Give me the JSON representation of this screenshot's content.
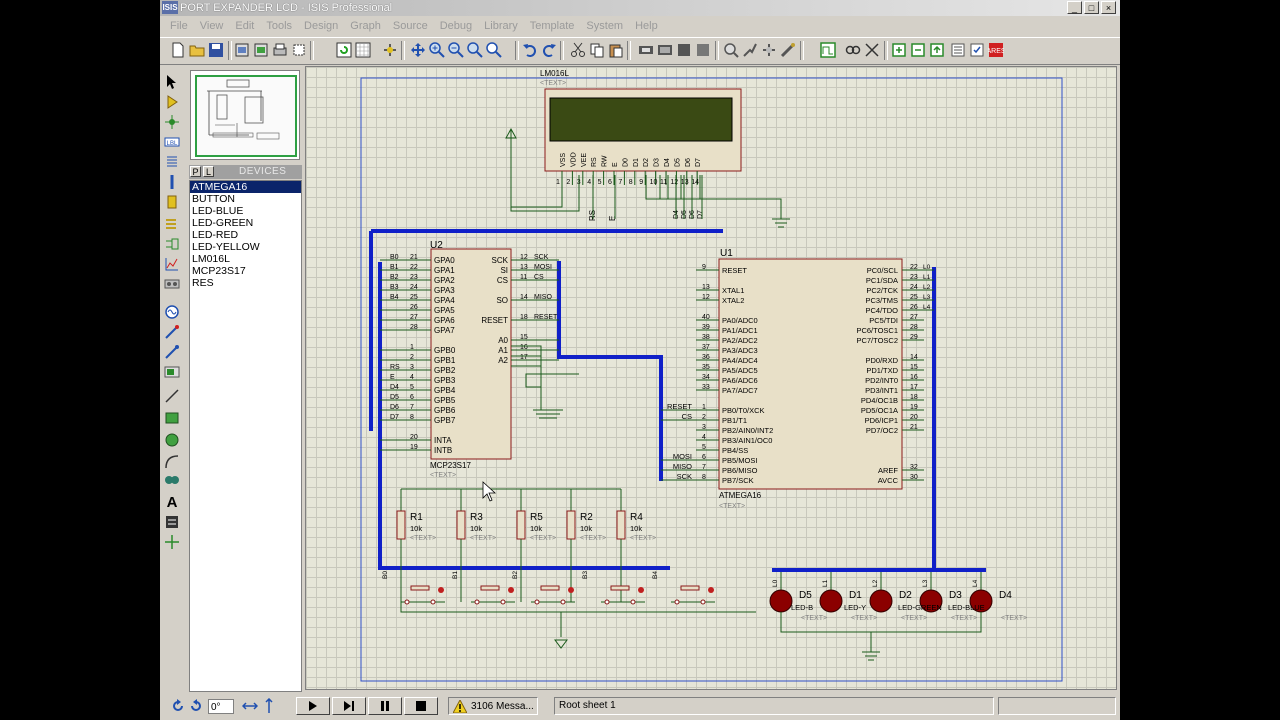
{
  "window": {
    "title": "PORT EXPANDER LCD - ISIS Professional",
    "app_icon": "ISIS",
    "minimize": "_",
    "maximize": "□",
    "close": "×"
  },
  "menu": [
    "File",
    "View",
    "Edit",
    "Tools",
    "Design",
    "Graph",
    "Source",
    "Debug",
    "Library",
    "Template",
    "System",
    "Help"
  ],
  "device_panel": {
    "p_label": "P",
    "l_label": "L",
    "title": "DEVICES",
    "items": [
      "ATMEGA16",
      "BUTTON",
      "LED-BLUE",
      "LED-GREEN",
      "LED-RED",
      "LED-YELLOW",
      "LM016L",
      "MCP23S17",
      "RES"
    ],
    "selected_index": 0
  },
  "status": {
    "rotation": "0°",
    "messages": "3106 Messa...",
    "sheet": "Root sheet 1"
  },
  "schematic": {
    "lcd": {
      "ref": "LM016L",
      "text": "<TEXT>",
      "pins": [
        "VSS",
        "VDD",
        "VEE",
        "RS",
        "RW",
        "E",
        "D0",
        "D1",
        "D2",
        "D3",
        "D4",
        "D5",
        "D6",
        "D7"
      ],
      "pin_numbers": [
        "1",
        "2",
        "3",
        "4",
        "5",
        "6",
        "7",
        "8",
        "9",
        "10",
        "11",
        "12",
        "13",
        "14"
      ],
      "rs_label": "RS",
      "e_label": "E",
      "bus_labels": [
        "D4",
        "D5",
        "D6",
        "D7"
      ]
    },
    "u2": {
      "ref": "U2",
      "part": "MCP23S17",
      "text": "<TEXT>",
      "left_pins": [
        "GPA0",
        "GPA1",
        "GPA2",
        "GPA3",
        "GPA4",
        "GPA5",
        "GPA6",
        "GPA7",
        "GPB0",
        "GPB1",
        "GPB2",
        "GPB3",
        "GPB4",
        "GPB5",
        "GPB6",
        "GPB7",
        "INTA",
        "INTB"
      ],
      "left_nums": [
        "21",
        "22",
        "23",
        "24",
        "25",
        "26",
        "27",
        "28",
        "1",
        "2",
        "3",
        "4",
        "5",
        "6",
        "7",
        "8",
        "20",
        "19"
      ],
      "left_nets": [
        "B0",
        "B1",
        "B2",
        "B3",
        "B4",
        "",
        "",
        "",
        "",
        "",
        "RS",
        "E",
        "D4",
        "D5",
        "D6",
        "D7",
        "",
        ""
      ],
      "right_pins": [
        "SCK",
        "SI",
        "CS",
        "SO",
        "RESET",
        "A0",
        "A1",
        "A2"
      ],
      "right_nums": [
        "12",
        "13",
        "11",
        "14",
        "18",
        "15",
        "16",
        "17"
      ],
      "right_nets": [
        "SCK",
        "MOSI",
        "CS",
        "MISO",
        "RESET",
        "",
        "",
        ""
      ]
    },
    "u1": {
      "ref": "U1",
      "part": "ATMEGA16",
      "text": "<TEXT>",
      "left_pins": [
        "RESET",
        "XTAL1",
        "XTAL2",
        "PA0/ADC0",
        "PA1/ADC1",
        "PA2/ADC2",
        "PA3/ADC3",
        "PA4/ADC4",
        "PA5/ADC5",
        "PA6/ADC6",
        "PA7/ADC7",
        "PB0/T0/XCK",
        "PB1/T1",
        "PB2/AIN0/INT2",
        "PB3/AIN1/OC0",
        "PB4/SS",
        "PB5/MOSI",
        "PB6/MISO",
        "PB7/SCK"
      ],
      "left_nums": [
        "9",
        "13",
        "12",
        "40",
        "39",
        "38",
        "37",
        "36",
        "35",
        "34",
        "33",
        "1",
        "2",
        "3",
        "4",
        "5",
        "6",
        "7",
        "8"
      ],
      "left_nets": [
        "",
        "",
        "",
        "",
        "",
        "",
        "",
        "",
        "",
        "",
        "",
        "RESET",
        "CS",
        "",
        "",
        "",
        "MOSI",
        "MISO",
        "SCK"
      ],
      "right_pins": [
        "PC0/SCL",
        "PC1/SDA",
        "PC2/TCK",
        "PC3/TMS",
        "PC4/TDO",
        "PC5/TDI",
        "PC6/TOSC1",
        "PC7/TOSC2",
        "PD0/RXD",
        "PD1/TXD",
        "PD2/INT0",
        "PD3/INT1",
        "PD4/OC1B",
        "PD5/OC1A",
        "PD6/ICP1",
        "PD7/OC2",
        "AREF",
        "AVCC"
      ],
      "right_nums": [
        "22",
        "23",
        "24",
        "25",
        "26",
        "27",
        "28",
        "29",
        "14",
        "15",
        "16",
        "17",
        "18",
        "19",
        "20",
        "21",
        "32",
        "30"
      ],
      "right_nets": [
        "L0",
        "L1",
        "L2",
        "L3",
        "L4",
        "",
        "",
        "",
        "",
        "",
        "",
        "",
        "",
        "",
        "",
        "",
        "",
        ""
      ]
    },
    "resistors": [
      {
        "ref": "R1",
        "value": "10k"
      },
      {
        "ref": "R3",
        "value": "10k"
      },
      {
        "ref": "R5",
        "value": "10k"
      },
      {
        "ref": "R2",
        "value": "10k"
      },
      {
        "ref": "R4",
        "value": "10k"
      }
    ],
    "resistor_text": "<TEXT>",
    "button_nets": [
      "B0",
      "B1",
      "B2",
      "B3",
      "B4"
    ],
    "leds": [
      {
        "ref": "D5",
        "part": "LED-BLUE"
      },
      {
        "ref": "D1",
        "part": "LED-YELLOW"
      },
      {
        "ref": "D2",
        "part": "LED-YELLOW"
      },
      {
        "ref": "D3",
        "part": "LED-GREEN"
      },
      {
        "ref": "D4",
        "part": "LED-BLUE"
      }
    ],
    "led_parts_visible": [
      "LED-B",
      "LED-Y",
      "LED-GREEN",
      "LED-BLUE"
    ],
    "led_nets": [
      "L0",
      "L1",
      "L2",
      "L3",
      "L4"
    ],
    "led_text": "<TEXT>"
  },
  "colors": {
    "wire": "#1a5a1a",
    "bus": "#1020c8",
    "component": "#8b1a1a",
    "component_fill": "#e8e0c8",
    "lcd_screen": "#3a4a14",
    "sheet_border": "#3050c8",
    "led": "#8b0000"
  }
}
